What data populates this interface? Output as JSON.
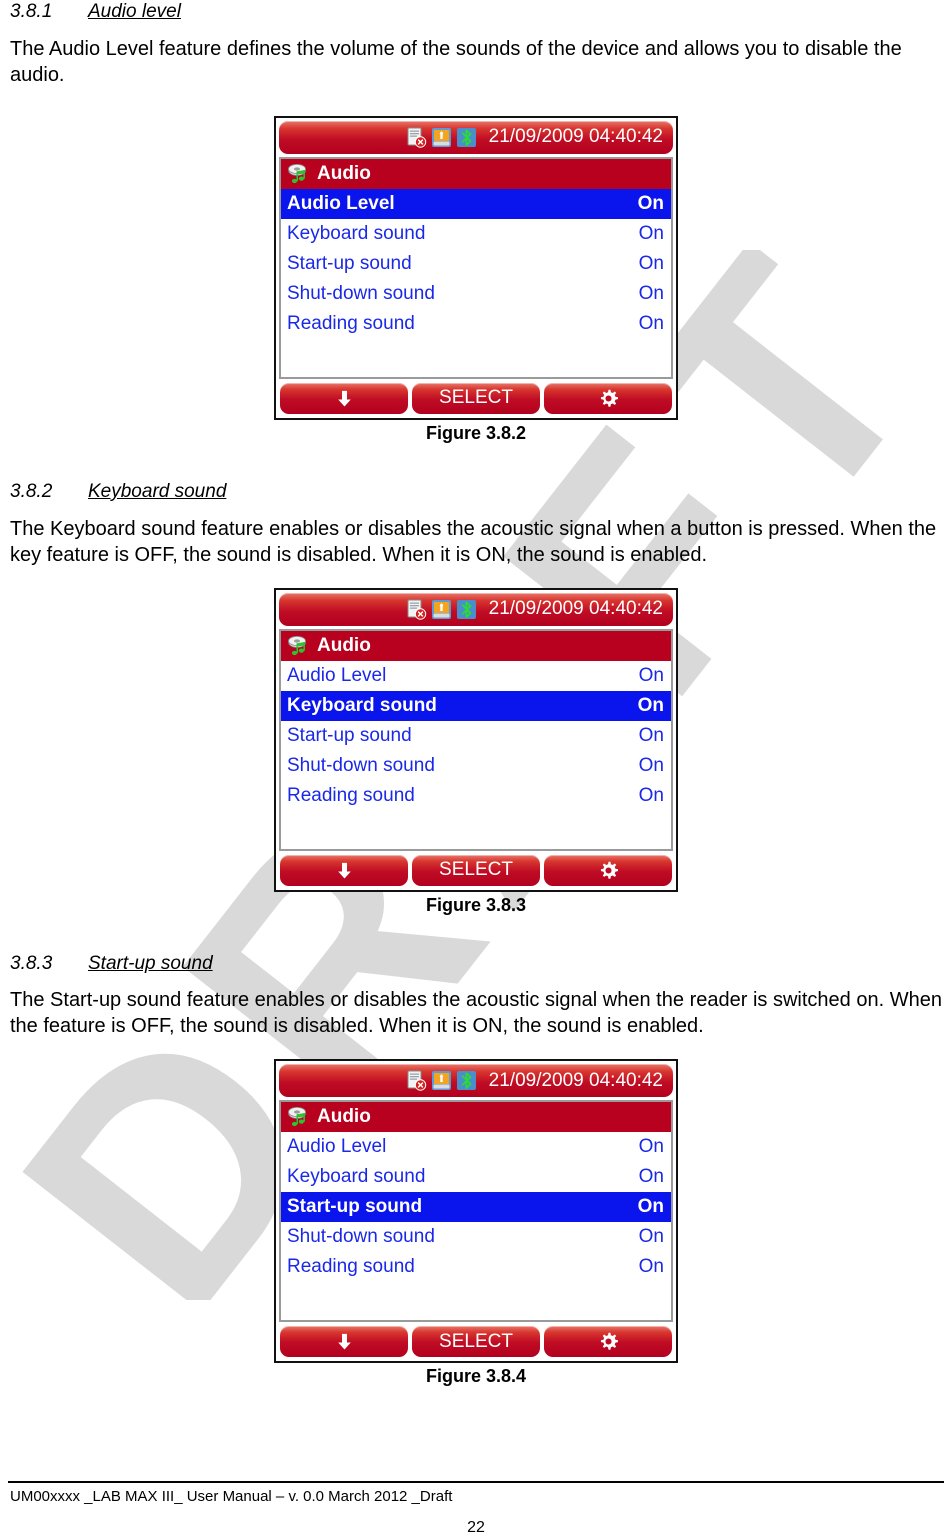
{
  "watermark": {
    "text": "DRAFT"
  },
  "sections": [
    {
      "number": "3.8.1",
      "title": "Audio level",
      "body": "The Audio Level feature defines the volume of the sounds of the device and allows you to disable the audio.",
      "figure_caption": "Figure 3.8.2"
    },
    {
      "number": "3.8.2",
      "title": "Keyboard sound",
      "body": "The Keyboard sound feature enables or disables the acoustic signal when a button is pressed. When the key feature is OFF, the sound is disabled. When it is ON, the sound is enabled.",
      "figure_caption": "Figure 3.8.3"
    },
    {
      "number": "3.8.3",
      "title": "Start-up sound",
      "body": "The Start-up sound feature enables or disables the acoustic signal when the reader is switched on. When the feature is OFF, the sound is disabled. When it is ON, the sound is enabled.",
      "figure_caption": "Figure 3.8.4"
    }
  ],
  "device_screens": [
    {
      "status_bar": {
        "datetime": "21/09/2009 04:40:42",
        "icons": [
          "memory-card-error-icon",
          "usb-device-icon",
          "bluetooth-icon"
        ]
      },
      "menu_title": {
        "label": "Audio",
        "icon": "audio-speaker-note-icon"
      },
      "rows": [
        {
          "label": "Audio Level",
          "value": "On",
          "selected": true
        },
        {
          "label": "Keyboard sound",
          "value": "On",
          "selected": false
        },
        {
          "label": "Start-up sound",
          "value": "On",
          "selected": false
        },
        {
          "label": "Shut-down sound",
          "value": "On",
          "selected": false
        },
        {
          "label": "Reading sound",
          "value": "On",
          "selected": false
        }
      ],
      "softkeys": [
        {
          "label": "",
          "icon": "arrow-down-icon"
        },
        {
          "label": "SELECT",
          "icon": ""
        },
        {
          "label": "",
          "icon": "gear-icon"
        }
      ]
    },
    {
      "status_bar": {
        "datetime": "21/09/2009 04:40:42",
        "icons": [
          "memory-card-error-icon",
          "usb-device-icon",
          "bluetooth-icon"
        ]
      },
      "menu_title": {
        "label": "Audio",
        "icon": "audio-speaker-note-icon"
      },
      "rows": [
        {
          "label": "Audio Level",
          "value": "On",
          "selected": false
        },
        {
          "label": "Keyboard sound",
          "value": "On",
          "selected": true
        },
        {
          "label": "Start-up sound",
          "value": "On",
          "selected": false
        },
        {
          "label": "Shut-down sound",
          "value": "On",
          "selected": false
        },
        {
          "label": "Reading sound",
          "value": "On",
          "selected": false
        }
      ],
      "softkeys": [
        {
          "label": "",
          "icon": "arrow-down-icon"
        },
        {
          "label": "SELECT",
          "icon": ""
        },
        {
          "label": "",
          "icon": "gear-icon"
        }
      ]
    },
    {
      "status_bar": {
        "datetime": "21/09/2009 04:40:42",
        "icons": [
          "memory-card-error-icon",
          "usb-device-icon",
          "bluetooth-icon"
        ]
      },
      "menu_title": {
        "label": "Audio",
        "icon": "audio-speaker-note-icon"
      },
      "rows": [
        {
          "label": "Audio Level",
          "value": "On",
          "selected": false
        },
        {
          "label": "Keyboard sound",
          "value": "On",
          "selected": false
        },
        {
          "label": "Start-up sound",
          "value": "On",
          "selected": true
        },
        {
          "label": "Shut-down sound",
          "value": "On",
          "selected": false
        },
        {
          "label": "Reading sound",
          "value": "On",
          "selected": false
        }
      ],
      "softkeys": [
        {
          "label": "",
          "icon": "arrow-down-icon"
        },
        {
          "label": "SELECT",
          "icon": ""
        },
        {
          "label": "",
          "icon": "gear-icon"
        }
      ]
    }
  ],
  "footer": {
    "text": "UM00xxxx _LAB MAX III_ User Manual – v. 0.0 March 2012 _Draft",
    "page_number": "22"
  },
  "colors": {
    "status_bar_red": "#b8001f",
    "menu_title_red": "#b8001f",
    "selected_blue": "#0a14ec",
    "row_text_blue": "#1a28e8",
    "watermark_gray": "#d9d9d9"
  }
}
